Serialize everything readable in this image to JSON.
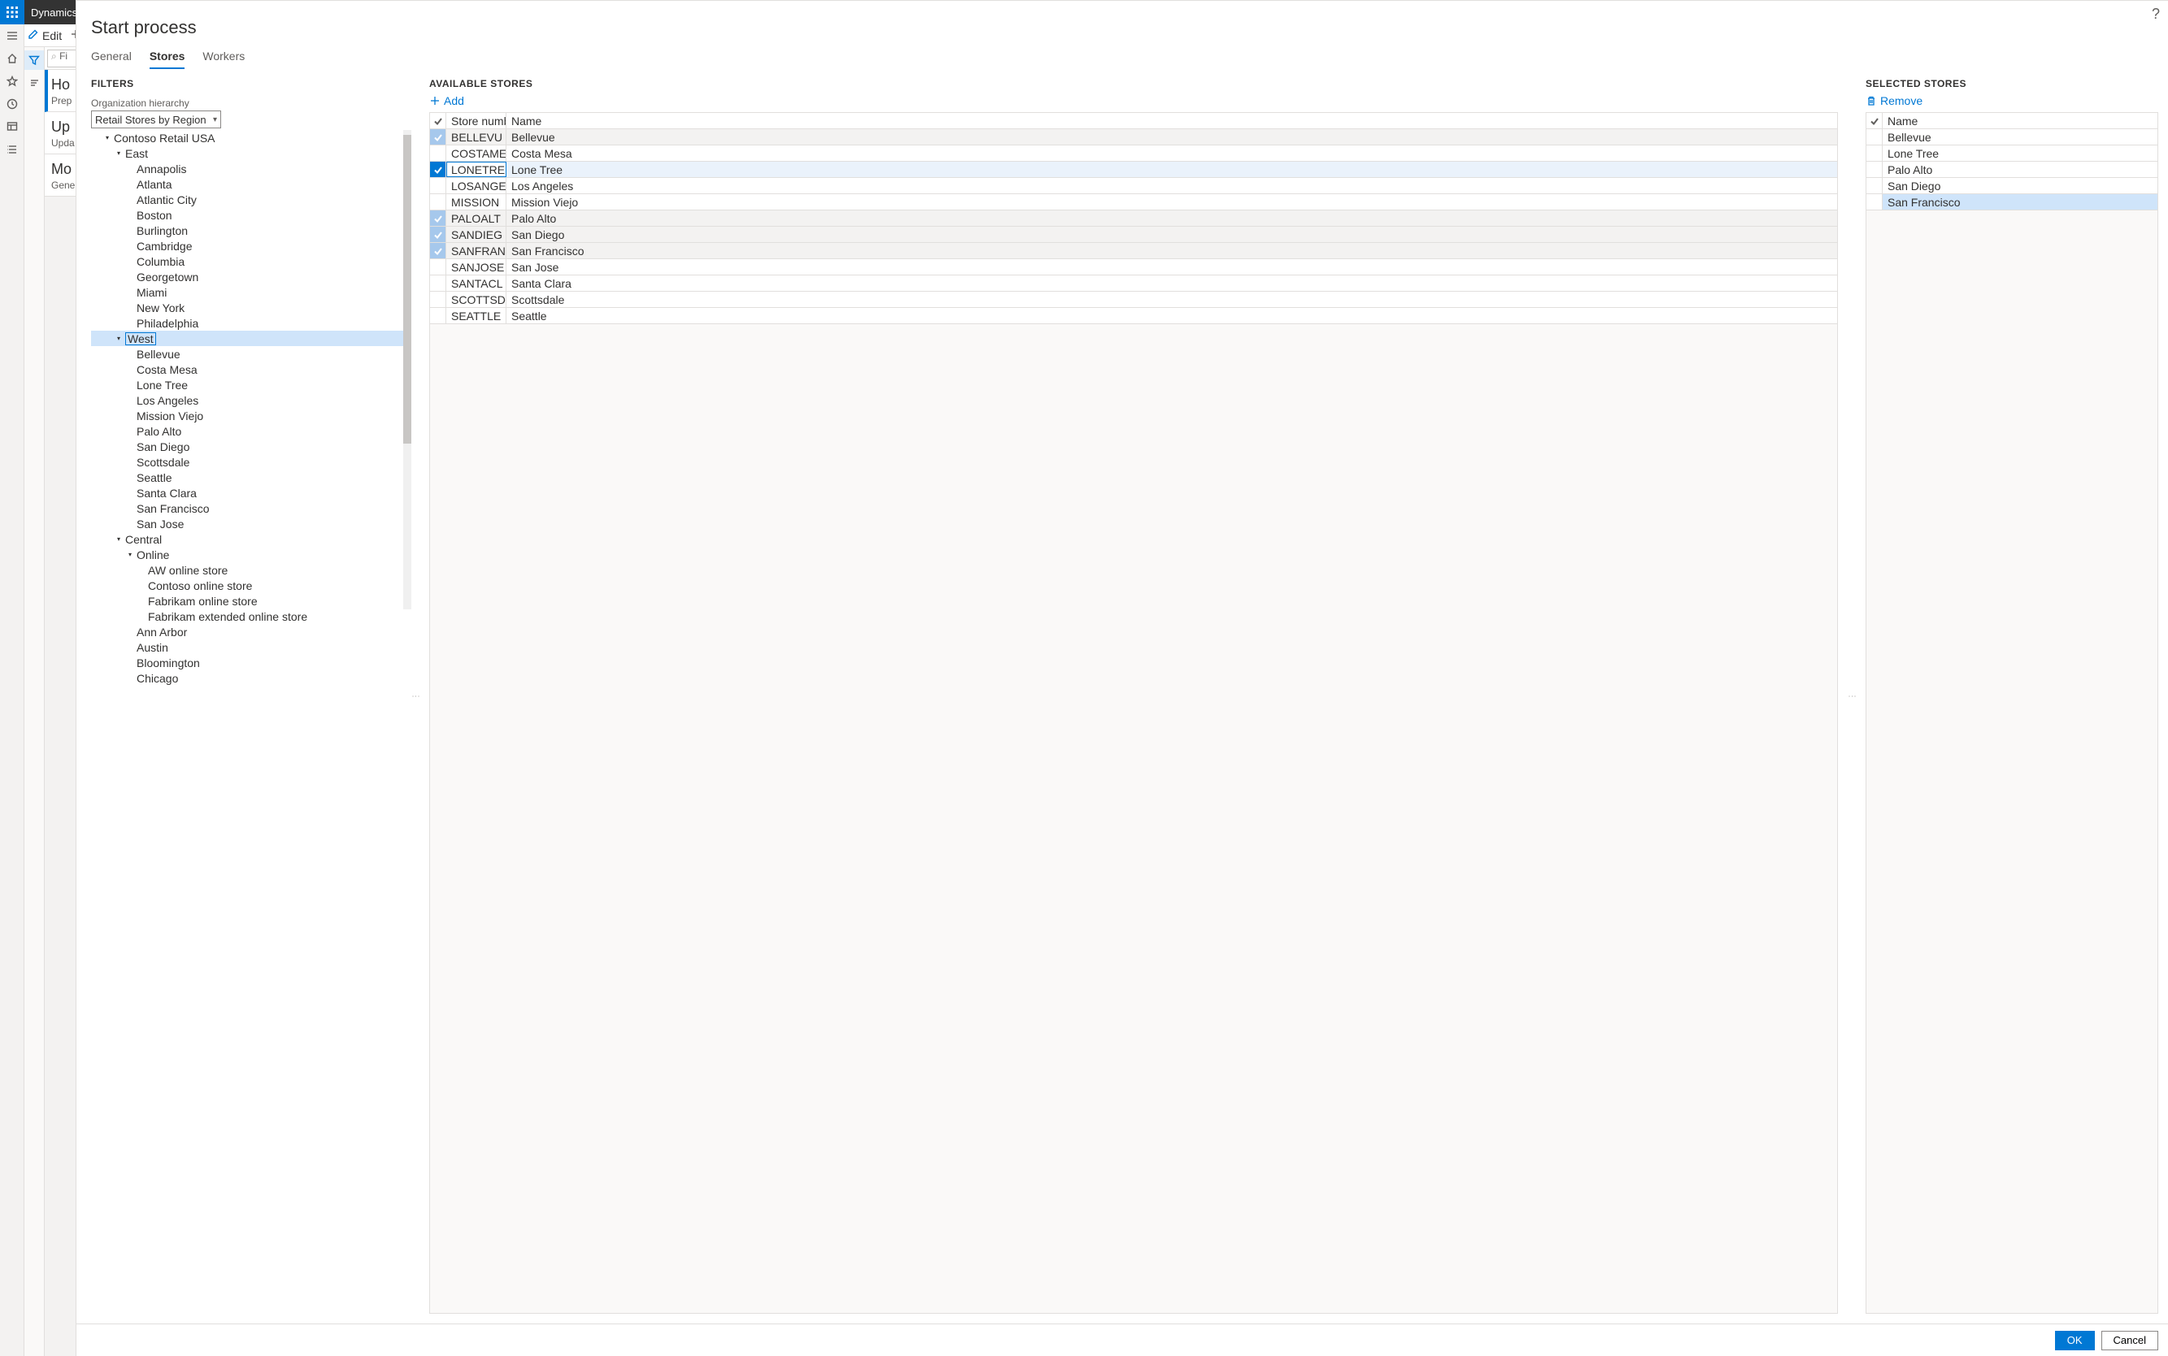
{
  "app_name": "Dynamics",
  "toolbar": {
    "edit": "Edit"
  },
  "under_filter_placeholder": "Fi",
  "under_cards": [
    {
      "title": "Ho",
      "sub": "Prep",
      "selected": true
    },
    {
      "title": "Up",
      "sub": "Upda",
      "selected": false
    },
    {
      "title": "Mo",
      "sub": "Gene",
      "selected": false
    }
  ],
  "modal_title": "Start process",
  "tabs": [
    {
      "id": "general",
      "label": "General",
      "active": false
    },
    {
      "id": "stores",
      "label": "Stores",
      "active": true
    },
    {
      "id": "workers",
      "label": "Workers",
      "active": false
    }
  ],
  "filters_caption": "FILTERS",
  "org_hierarchy_label": "Organization hierarchy",
  "org_hierarchy_value": "Retail Stores by Region",
  "tree": [
    {
      "depth": 1,
      "exp": "down",
      "label": "Contoso Retail USA"
    },
    {
      "depth": 2,
      "exp": "down",
      "label": "East"
    },
    {
      "depth": 3,
      "exp": "",
      "label": "Annapolis"
    },
    {
      "depth": 3,
      "exp": "",
      "label": "Atlanta"
    },
    {
      "depth": 3,
      "exp": "",
      "label": "Atlantic City"
    },
    {
      "depth": 3,
      "exp": "",
      "label": "Boston"
    },
    {
      "depth": 3,
      "exp": "",
      "label": "Burlington"
    },
    {
      "depth": 3,
      "exp": "",
      "label": "Cambridge"
    },
    {
      "depth": 3,
      "exp": "",
      "label": "Columbia"
    },
    {
      "depth": 3,
      "exp": "",
      "label": "Georgetown"
    },
    {
      "depth": 3,
      "exp": "",
      "label": "Miami"
    },
    {
      "depth": 3,
      "exp": "",
      "label": "New York"
    },
    {
      "depth": 3,
      "exp": "",
      "label": "Philadelphia"
    },
    {
      "depth": 2,
      "exp": "down",
      "label": "West",
      "selected": true
    },
    {
      "depth": 3,
      "exp": "",
      "label": "Bellevue"
    },
    {
      "depth": 3,
      "exp": "",
      "label": "Costa Mesa"
    },
    {
      "depth": 3,
      "exp": "",
      "label": "Lone Tree"
    },
    {
      "depth": 3,
      "exp": "",
      "label": "Los Angeles"
    },
    {
      "depth": 3,
      "exp": "",
      "label": "Mission Viejo"
    },
    {
      "depth": 3,
      "exp": "",
      "label": "Palo Alto"
    },
    {
      "depth": 3,
      "exp": "",
      "label": "San Diego"
    },
    {
      "depth": 3,
      "exp": "",
      "label": "Scottsdale"
    },
    {
      "depth": 3,
      "exp": "",
      "label": "Seattle"
    },
    {
      "depth": 3,
      "exp": "",
      "label": "Santa Clara"
    },
    {
      "depth": 3,
      "exp": "",
      "label": "San Francisco"
    },
    {
      "depth": 3,
      "exp": "",
      "label": "San Jose"
    },
    {
      "depth": 2,
      "exp": "down",
      "label": "Central"
    },
    {
      "depth": 3,
      "exp": "down",
      "label": "Online"
    },
    {
      "depth": 4,
      "exp": "",
      "label": "AW online store"
    },
    {
      "depth": 4,
      "exp": "",
      "label": "Contoso online store"
    },
    {
      "depth": 4,
      "exp": "",
      "label": "Fabrikam online store"
    },
    {
      "depth": 4,
      "exp": "",
      "label": "Fabrikam extended online store"
    },
    {
      "depth": 3,
      "exp": "",
      "label": "Ann Arbor"
    },
    {
      "depth": 3,
      "exp": "",
      "label": "Austin"
    },
    {
      "depth": 3,
      "exp": "",
      "label": "Bloomington"
    },
    {
      "depth": 3,
      "exp": "",
      "label": "Chicago"
    }
  ],
  "available_caption": "AVAILABLE STORES",
  "add_label": "Add",
  "available_columns": {
    "store_number": "Store number",
    "name": "Name"
  },
  "available_rows": [
    {
      "num": "BELLEVU",
      "name": "Bellevue",
      "state": "soft"
    },
    {
      "num": "COSTAME",
      "name": "Costa Mesa",
      "state": ""
    },
    {
      "num": "LONETRE",
      "name": "Lone Tree",
      "state": "hard"
    },
    {
      "num": "LOSANGE",
      "name": "Los Angeles",
      "state": ""
    },
    {
      "num": "MISSION",
      "name": "Mission Viejo",
      "state": ""
    },
    {
      "num": "PALOALT",
      "name": "Palo Alto",
      "state": "soft"
    },
    {
      "num": "SANDIEG",
      "name": "San Diego",
      "state": "soft"
    },
    {
      "num": "SANFRANCIS",
      "name": "San Francisco",
      "state": "soft"
    },
    {
      "num": "SANJOSE",
      "name": "San Jose",
      "state": ""
    },
    {
      "num": "SANTACL",
      "name": "Santa Clara",
      "state": ""
    },
    {
      "num": "SCOTTSD",
      "name": "Scottsdale",
      "state": ""
    },
    {
      "num": "SEATTLE",
      "name": "Seattle",
      "state": ""
    }
  ],
  "selected_caption": "SELECTED STORES",
  "remove_label": "Remove",
  "selected_column_name": "Name",
  "selected_rows": [
    {
      "name": "Bellevue",
      "highlight": false
    },
    {
      "name": "Lone Tree",
      "highlight": false
    },
    {
      "name": "Palo Alto",
      "highlight": false
    },
    {
      "name": "San Diego",
      "highlight": false
    },
    {
      "name": "San Francisco",
      "highlight": true
    }
  ],
  "buttons": {
    "ok": "OK",
    "cancel": "Cancel"
  }
}
